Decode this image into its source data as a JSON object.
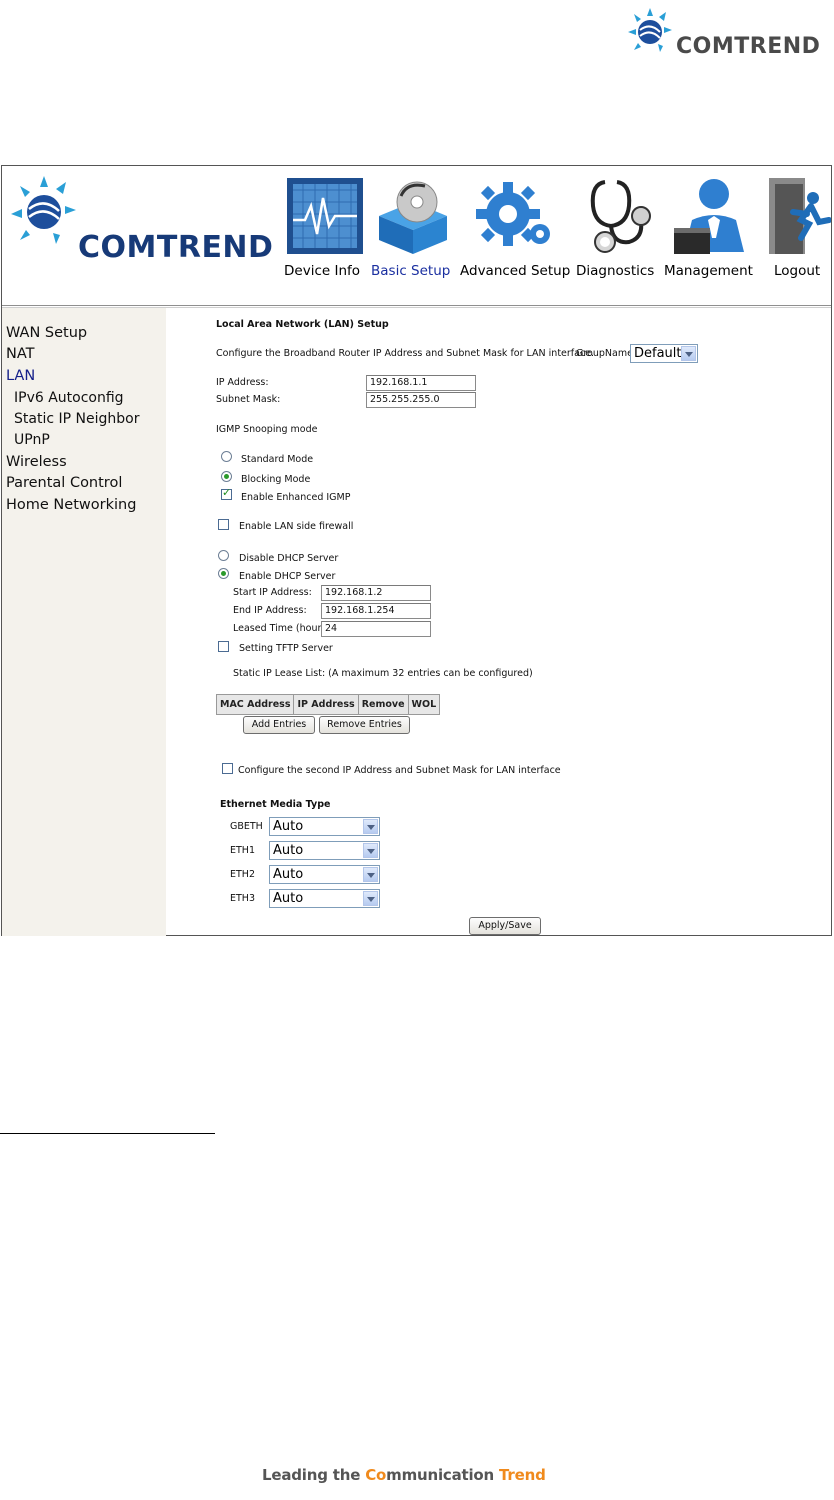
{
  "doc_header": {
    "logo_text": "COMTREND"
  },
  "app": {
    "logo_text": "COMTREND",
    "nav": [
      {
        "label": "Device Info",
        "icon": "device-info-icon"
      },
      {
        "label": "Basic Setup",
        "icon": "basic-setup-icon",
        "active": true
      },
      {
        "label": "Advanced Setup",
        "icon": "advanced-setup-icon"
      },
      {
        "label": "Diagnostics",
        "icon": "diagnostics-icon"
      },
      {
        "label": "Management",
        "icon": "management-icon"
      },
      {
        "label": "Logout",
        "icon": "logout-icon"
      }
    ],
    "sidebar": [
      {
        "label": "WAN Setup"
      },
      {
        "label": "NAT"
      },
      {
        "label": "LAN",
        "active": true
      },
      {
        "label": "IPv6 Autoconfig"
      },
      {
        "label": "Static IP Neighbor"
      },
      {
        "label": "UPnP"
      },
      {
        "label": "Wireless"
      },
      {
        "label": "Parental Control"
      },
      {
        "label": "Home Networking"
      }
    ],
    "lan": {
      "title": "Local Area Network (LAN) Setup",
      "description": "Configure the Broadband Router IP Address and Subnet Mask for LAN interface.",
      "group_name_label": "GroupName",
      "group_name_value": "Default",
      "ip_address_label": "IP Address:",
      "ip_address_value": "192.168.1.1",
      "subnet_mask_label": "Subnet Mask:",
      "subnet_mask_value": "255.255.255.0",
      "igmp_label": "IGMP Snooping mode",
      "standard_mode": "Standard Mode",
      "blocking_mode": "Blocking Mode",
      "enhanced_igmp": "Enable Enhanced IGMP",
      "lan_firewall": "Enable LAN side firewall",
      "disable_dhcp": "Disable DHCP Server",
      "enable_dhcp": "Enable DHCP Server",
      "start_ip_label": "Start IP Address:",
      "start_ip_value": "192.168.1.2",
      "end_ip_label": "End IP Address:",
      "end_ip_value": "192.168.1.254",
      "lease_label": "Leased Time (hour):",
      "lease_value": "24",
      "tftp_label": "Setting TFTP Server",
      "static_lease_label": "Static IP Lease List: (A maximum 32 entries can be configured)",
      "lease_columns": [
        "MAC Address",
        "IP Address",
        "Remove",
        "WOL"
      ],
      "add_entries": "Add Entries",
      "remove_entries": "Remove Entries",
      "second_ip_label": "Configure the second IP Address and Subnet Mask for LAN interface",
      "ethernet_media_title": "Ethernet Media Type",
      "ethernet_ports": [
        {
          "port": "GBETH",
          "value": "Auto"
        },
        {
          "port": "ETH1",
          "value": "Auto"
        },
        {
          "port": "ETH2",
          "value": "Auto"
        },
        {
          "port": "ETH3",
          "value": "Auto"
        }
      ],
      "apply_save": "Apply/Save"
    }
  },
  "footer": {
    "text_pre": "Leading the ",
    "text_co": "Co",
    "text_mm": "mmunication ",
    "text_trend": "Trend"
  },
  "colors": {
    "brand_blue": "#173a78",
    "active_link": "#15208a",
    "sidebar_bg": "#f4f2ec",
    "accent_orange": "#f08a1c"
  }
}
